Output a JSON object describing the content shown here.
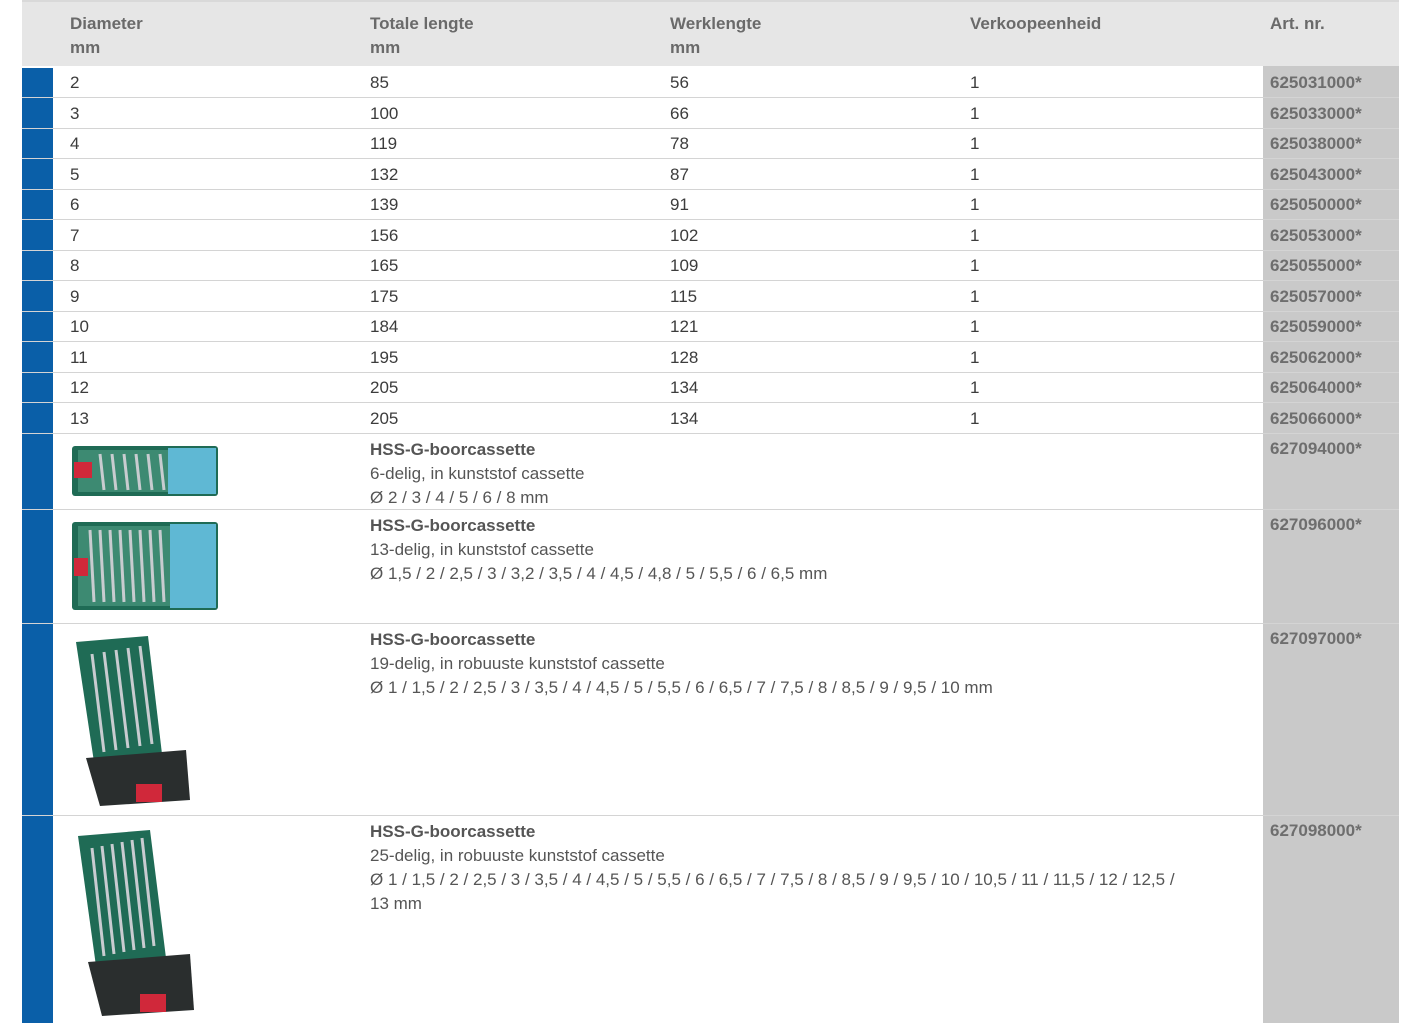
{
  "columns": {
    "diameter": [
      "Diameter",
      "mm"
    ],
    "total_length": [
      "Totale lengte",
      "mm"
    ],
    "work_length": [
      "Werklengte",
      "mm"
    ],
    "unit": [
      "Verkoopeenheid"
    ],
    "art": [
      "Art. nr."
    ]
  },
  "rows": [
    {
      "d": "2",
      "t": "85",
      "w": "56",
      "u": "1",
      "art": "625031000*"
    },
    {
      "d": "3",
      "t": "100",
      "w": "66",
      "u": "1",
      "art": "625033000*"
    },
    {
      "d": "4",
      "t": "119",
      "w": "78",
      "u": "1",
      "art": "625038000*"
    },
    {
      "d": "5",
      "t": "132",
      "w": "87",
      "u": "1",
      "art": "625043000*"
    },
    {
      "d": "6",
      "t": "139",
      "w": "91",
      "u": "1",
      "art": "625050000*"
    },
    {
      "d": "7",
      "t": "156",
      "w": "102",
      "u": "1",
      "art": "625053000*"
    },
    {
      "d": "8",
      "t": "165",
      "w": "109",
      "u": "1",
      "art": "625055000*"
    },
    {
      "d": "9",
      "t": "175",
      "w": "115",
      "u": "1",
      "art": "625057000*"
    },
    {
      "d": "10",
      "t": "184",
      "w": "121",
      "u": "1",
      "art": "625059000*"
    },
    {
      "d": "11",
      "t": "195",
      "w": "128",
      "u": "1",
      "art": "625062000*"
    },
    {
      "d": "12",
      "t": "205",
      "w": "134",
      "u": "1",
      "art": "625064000*"
    },
    {
      "d": "13",
      "t": "205",
      "w": "134",
      "u": "1",
      "art": "625066000*"
    }
  ],
  "products": [
    {
      "title": "HSS-G-boorcassette",
      "desc": "6-delig, in kunststof cassette",
      "sizes": "Ø 2 / 3 / 4 / 5 / 6 / 8 mm",
      "sizes2": "",
      "art": "627094000*"
    },
    {
      "title": "HSS-G-boorcassette",
      "desc": "13-delig, in kunststof cassette",
      "sizes": "Ø 1,5 / 2 / 2,5 / 3 / 3,2 / 3,5 / 4 / 4,5 / 4,8 / 5 / 5,5 / 6 / 6,5 mm",
      "sizes2": "",
      "art": "627096000*"
    },
    {
      "title": "HSS-G-boorcassette",
      "desc": "19-delig, in robuuste kunststof cassette",
      "sizes": "Ø 1 / 1,5 / 2 / 2,5 / 3 / 3,5 / 4 / 4,5 / 5 / 5,5 / 6 / 6,5 / 7 / 7,5 / 8 / 8,5 / 9 / 9,5 / 10 mm",
      "sizes2": "",
      "art": "627097000*"
    },
    {
      "title": "HSS-G-boorcassette",
      "desc": "25-delig, in robuuste kunststof cassette",
      "sizes": "Ø 1 / 1,5 / 2 / 2,5 / 3 / 3,5 / 4 / 4,5 / 5 / 5,5 / 6 / 6,5 / 7 / 7,5 / 8 / 8,5 / 9 / 9,5 / 10 / 10,5 / 11 / 11,5 / 12 / 12,5 /",
      "sizes2": "13 mm",
      "art": "627098000*"
    }
  ],
  "colors": {
    "stripe": "#0a5fa8",
    "header_bg": "#e6e6e6",
    "art_bg": "#c9c9c9",
    "case_green": "#1f6b55",
    "case_red": "#d0283a"
  }
}
